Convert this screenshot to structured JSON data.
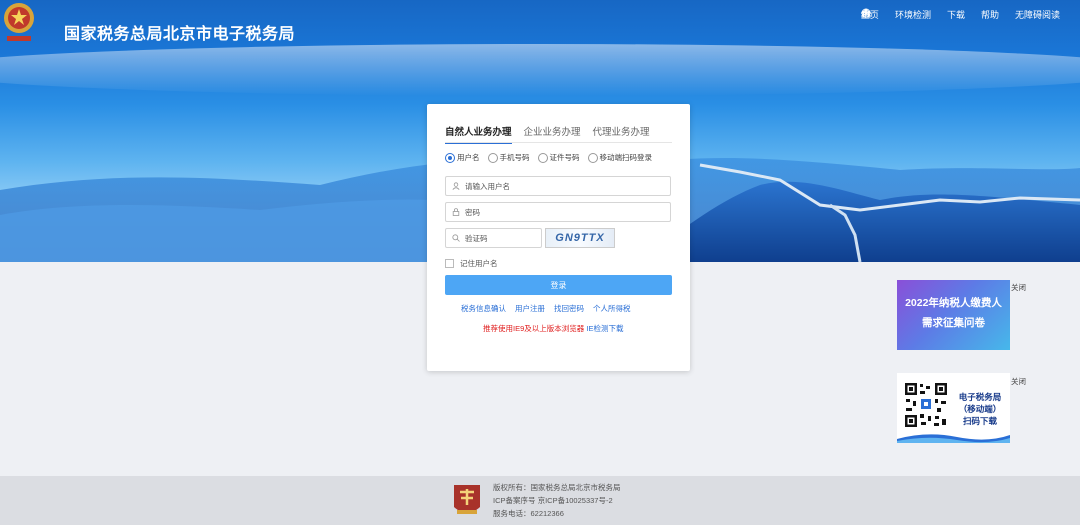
{
  "header": {
    "title": "国家税务总局北京市电子税务局",
    "nav": [
      {
        "label": "主页",
        "icon": "home-icon"
      },
      {
        "label": "环境检测",
        "icon": "wrench-icon"
      },
      {
        "label": "下载",
        "icon": "download-icon"
      },
      {
        "label": "帮助",
        "icon": "help-icon"
      },
      {
        "label": "无障碍阅读",
        "icon": "eye-icon"
      }
    ]
  },
  "login": {
    "tabs": [
      "自然人业务办理",
      "企业业务办理",
      "代理业务办理"
    ],
    "active_tab": 0,
    "radios": [
      "用户名",
      "手机号码",
      "证件号码",
      "移动端扫码登录"
    ],
    "checked_radio": 0,
    "username_placeholder": "请输入用户名",
    "password_placeholder": "密码",
    "captcha_placeholder": "验证码",
    "captcha_text": "GN9TTX",
    "remember_label": "记住用户名",
    "login_button": "登录",
    "links": [
      "税务信息确认",
      "用户注册",
      "找回密码",
      "个人所得税"
    ],
    "tip_red": "推荐使用IE9及以上版本浏览器",
    "tip_blue": "IE检测下载"
  },
  "ads": {
    "ad1_line1": "2022年纳税人缴费人",
    "ad1_line2": "需求征集问卷",
    "ad2_line1": "电子税务局",
    "ad2_line2": "（移动端）",
    "ad2_line3": "扫码下载",
    "close_label": "关闭"
  },
  "footer": {
    "copyright": "版权所有：国家税务总局北京市税务局",
    "icp": "ICP备案序号 京ICP备10025337号-2",
    "phone": "服务电话：62212366"
  },
  "colors": {
    "primary": "#2a6fd6",
    "button": "#4da6f5",
    "header_top": "#1767c4",
    "tip_red": "#e02020"
  }
}
